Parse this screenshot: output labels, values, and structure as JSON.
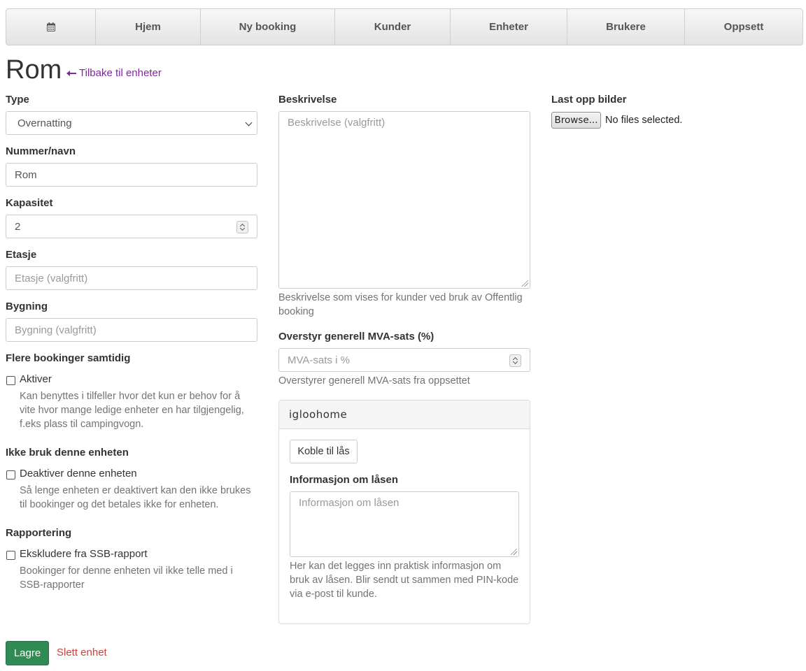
{
  "nav": {
    "calendar_icon": "calendar-icon",
    "items": [
      "Hjem",
      "Ny booking",
      "Kunder",
      "Enheter",
      "Brukere",
      "Oppsett"
    ]
  },
  "page": {
    "title": "Rom",
    "back_link": "Tilbake til enheter"
  },
  "form": {
    "type_label": "Type",
    "type_value": "Overnatting",
    "name_label": "Nummer/navn",
    "name_value": "Rom",
    "capacity_label": "Kapasitet",
    "capacity_value": "2",
    "floor_label": "Etasje",
    "floor_placeholder": "Etasje (valgfritt)",
    "building_label": "Bygning",
    "building_placeholder": "Bygning (valgfritt)",
    "multi_label": "Flere bookinger samtidig",
    "multi_checkbox": "Aktiver",
    "multi_help": "Kan benyttes i tilfeller hvor det kun er behov for å vite hvor mange ledige enheter en har tilgjengelig, f.eks plass til campingvogn.",
    "disable_label": "Ikke bruk denne enheten",
    "disable_checkbox": "Deaktiver denne enheten",
    "disable_help": "Så lenge enheten er deaktivert kan den ikke brukes til bookinger og det betales ikke for enheten.",
    "report_label": "Rapportering",
    "report_checkbox": "Ekskludere fra SSB-rapport",
    "report_help": "Bookinger for denne enheten vil ikke telle med i SSB-rapporter",
    "description_label": "Beskrivelse",
    "description_placeholder": "Beskrivelse (valgfritt)",
    "description_help": "Beskrivelse som vises for kunder ved bruk av Offentlig booking",
    "vat_label": "Overstyr generell MVA-sats (%)",
    "vat_placeholder": "MVA-sats i %",
    "vat_help": "Overstyrer generell MVA-sats fra oppsettet",
    "upload_label": "Last opp bilder",
    "browse_button": "Browse...",
    "no_files": "No files selected."
  },
  "igloohome": {
    "brand": "igloohome",
    "connect_button": "Koble til lås",
    "info_label": "Informasjon om låsen",
    "info_placeholder": "Informasjon om låsen",
    "info_help": "Her kan det legges inn praktisk informasjon om bruk av låsen. Blir sendt ut sammen med PIN-kode via e-post til kunde."
  },
  "actions": {
    "save": "Lagre",
    "delete": "Slett enhet"
  },
  "colors": {
    "save_button": "#2f8a53",
    "delete_link": "#c9413b",
    "back_link": "#7b2a9b"
  }
}
